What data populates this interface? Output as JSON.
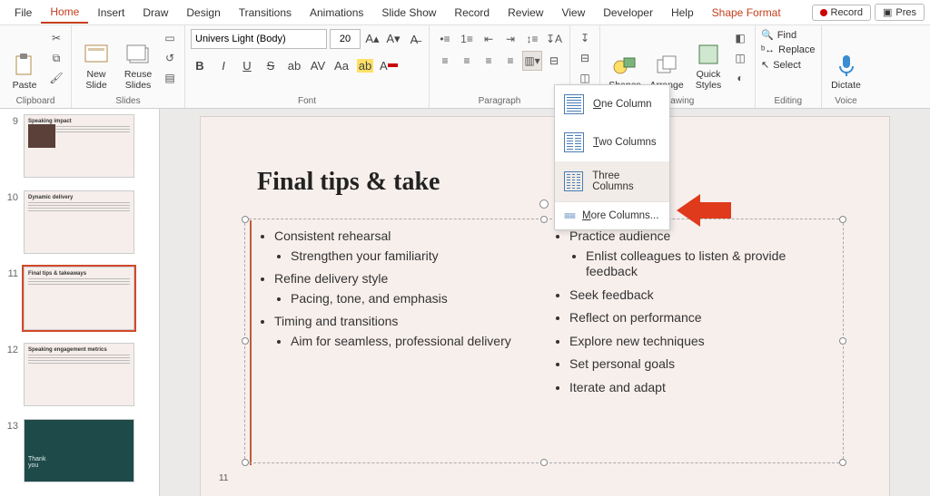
{
  "menu": {
    "tabs": [
      "File",
      "Home",
      "Insert",
      "Draw",
      "Design",
      "Transitions",
      "Animations",
      "Slide Show",
      "Record",
      "Review",
      "View",
      "Developer",
      "Help"
    ],
    "contextual": "Shape Format",
    "record_btn": "Record",
    "present_btn": "Pres"
  },
  "ribbon": {
    "clipboard": {
      "paste": "Paste",
      "label": "Clipboard"
    },
    "slides": {
      "new": "New\nSlide",
      "reuse": "Reuse\nSlides",
      "label": "Slides"
    },
    "font": {
      "name": "Univers Light (Body)",
      "size": "20",
      "label": "Font",
      "buttons": {
        "bold": "B",
        "italic": "I",
        "underline": "U",
        "strike": "S",
        "shadow": "ab",
        "spacing": "AV",
        "case": "Aa"
      }
    },
    "paragraph": {
      "label": "Paragraph"
    },
    "drawing": {
      "shapes": "Shapes",
      "arrange": "Arrange",
      "quick": "Quick\nStyles",
      "label": "Drawing"
    },
    "editing": {
      "find": "Find",
      "replace": "Replace",
      "select": "Select",
      "label": "Editing"
    },
    "voice": {
      "dictate": "Dictate",
      "label": "Voice"
    }
  },
  "columns_menu": {
    "one": "One Column",
    "two": "Two Columns",
    "three": "Three Columns",
    "more": "More Columns..."
  },
  "thumbnails": [
    {
      "num": "9",
      "title": "Speaking impact"
    },
    {
      "num": "10",
      "title": "Dynamic delivery"
    },
    {
      "num": "11",
      "title": "Final tips & takeaways"
    },
    {
      "num": "12",
      "title": "Speaking engagement metrics"
    },
    {
      "num": "13",
      "title": "Thank you"
    }
  ],
  "slide": {
    "title": "Final tips & take",
    "number": "11",
    "col1": [
      {
        "t": "Consistent rehearsal",
        "sub": [
          "Strengthen your familiarity"
        ]
      },
      {
        "t": "Refine delivery style",
        "sub": [
          "Pacing, tone, and emphasis"
        ]
      },
      {
        "t": "Timing and transitions",
        "sub": [
          "Aim for seamless, professional delivery"
        ]
      }
    ],
    "col2": [
      {
        "t": "Practice audience",
        "sub": [
          "Enlist colleagues to listen & provide feedback"
        ]
      },
      {
        "t": "Seek feedback"
      },
      {
        "t": "Reflect on performance"
      },
      {
        "t": "Explore new techniques"
      },
      {
        "t": "Set personal goals"
      },
      {
        "t": "Iterate and adapt"
      }
    ]
  }
}
